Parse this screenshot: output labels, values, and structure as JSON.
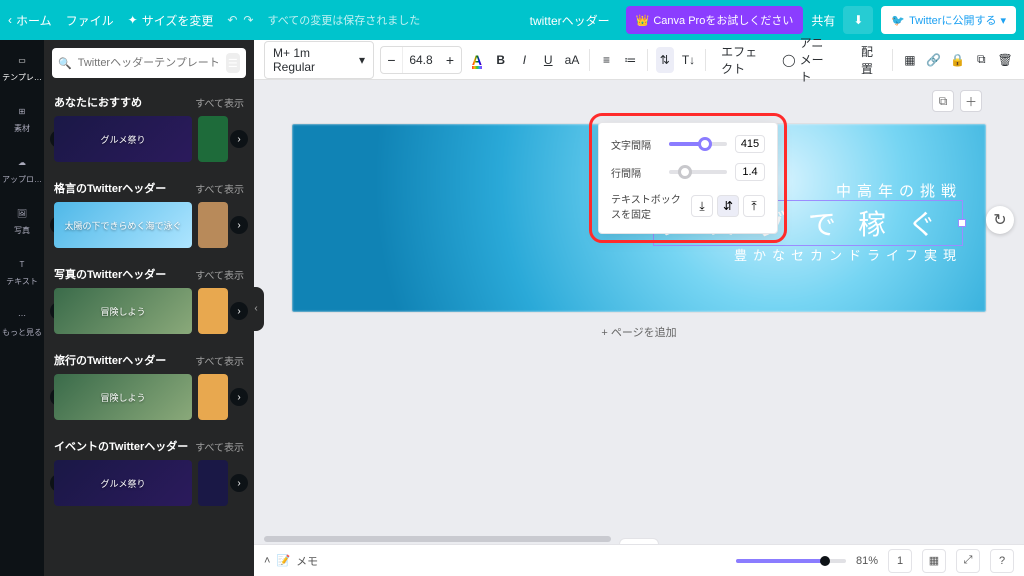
{
  "topbar": {
    "home": "ホーム",
    "file": "ファイル",
    "resize": "サイズを変更",
    "saved": "すべての変更は保存されました",
    "project_title": "twitterヘッダー",
    "try_pro": "Canva Proをお試しください",
    "share": "共有",
    "publish_twitter": "Twitterに公開する"
  },
  "rail": {
    "templates": "テンプレ…",
    "elements": "素材",
    "uploads": "アップロ…",
    "photos": "写真",
    "text": "テキスト",
    "more": "もっと見る"
  },
  "panel": {
    "search_placeholder": "Twitterヘッダーテンプレートを検索",
    "sections": [
      {
        "title": "あなたにおすすめ",
        "see_all": "すべて表示",
        "thumb_text": "グルメ祭り"
      },
      {
        "title": "格言のTwitterヘッダー",
        "see_all": "すべて表示",
        "thumb_text": "太陽の下できらめく海で泳ぐ"
      },
      {
        "title": "写真のTwitterヘッダー",
        "see_all": "すべて表示",
        "thumb_text": "冒険しよう"
      },
      {
        "title": "旅行のTwitterヘッダー",
        "see_all": "すべて表示",
        "thumb_text": "冒険しよう"
      },
      {
        "title": "イベントのTwitterヘッダー",
        "see_all": "すべて表示",
        "thumb_text": "グルメ祭り"
      }
    ]
  },
  "toolbar": {
    "font": "M+ 1m Regular",
    "font_size": "64.8",
    "bold": "B",
    "italic": "I",
    "underline": "U",
    "case": "aA",
    "effects": "エフェクト",
    "animate": "アニメート",
    "position": "配置"
  },
  "spacing": {
    "letter_label": "文字間隔",
    "letter_value": "415",
    "letter_pct": 62,
    "line_label": "行間隔",
    "line_value": "1.4",
    "line_pct": 28,
    "anchor_label": "テキストボックスを固定",
    "accent": "#8b7cff"
  },
  "canvas_text": {
    "line1": "中高年の挑戦",
    "line2": "ブログで稼ぐ",
    "line3": "豊かなセカンドライフ実現"
  },
  "add_page": "+ ページを追加",
  "statusbar": {
    "notes": "メモ",
    "zoom": "81%",
    "page_indicator": "1"
  }
}
